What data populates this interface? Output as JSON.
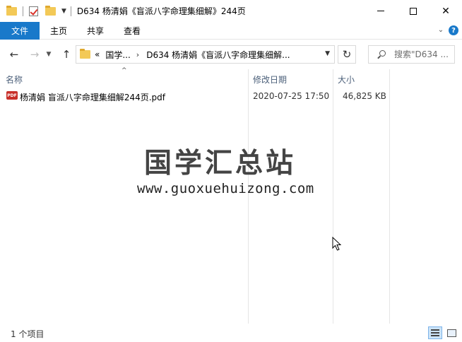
{
  "window": {
    "title": "D634 杨清娟《盲派八字命理集细解》244页"
  },
  "ribbon": {
    "tabs": [
      {
        "label": "文件",
        "active": true
      },
      {
        "label": "主页"
      },
      {
        "label": "共享"
      },
      {
        "label": "查看"
      }
    ]
  },
  "address": {
    "overflow": "«",
    "segments": [
      "国学...",
      "D634 杨清娟《盲派八字命理集细解..."
    ]
  },
  "search": {
    "placeholder": "搜索\"D634 ..."
  },
  "columns": {
    "name": "名称",
    "date": "修改日期",
    "size": "大小"
  },
  "files": [
    {
      "icon": "pdf-icon",
      "name": "杨清娟 盲派八字命理集细解244页.pdf",
      "modified": "2020-07-25 17:50",
      "size": "46,825 KB"
    }
  ],
  "watermark": {
    "title": "国学汇总站",
    "url": "www.guoxuehuizong.com"
  },
  "status": {
    "item_count": "1 个项目"
  },
  "colors": {
    "accent": "#1979ca",
    "header_text": "#4c607a",
    "pdf_red": "#c8302a",
    "folder_yellow": "#f3c957"
  }
}
